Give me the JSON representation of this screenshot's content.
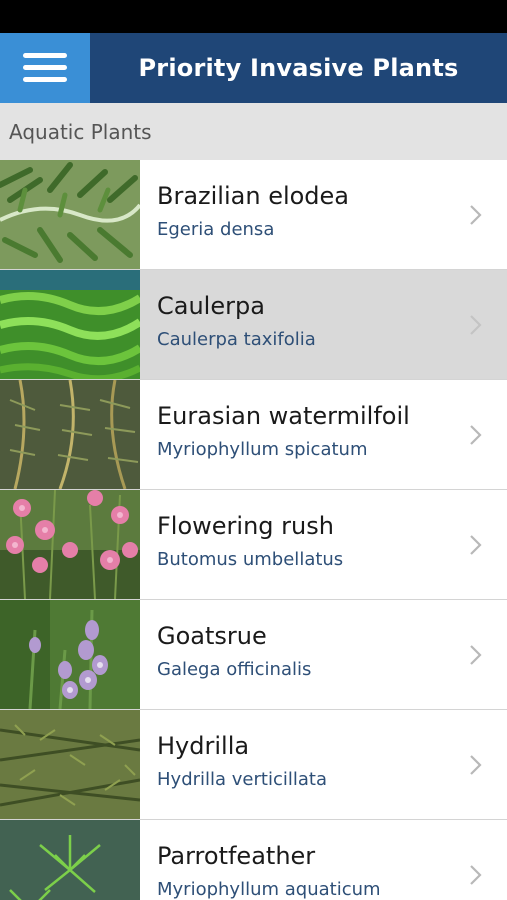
{
  "header": {
    "title": "Priority Invasive Plants",
    "menu_icon": "hamburger-menu-icon"
  },
  "section": {
    "title": "Aquatic Plants"
  },
  "colors": {
    "header_bg": "#1f4677",
    "menu_bg": "#3a8fd6",
    "section_bg": "#e3e3e3",
    "selected_row_bg": "#d9d9d9",
    "scientific_name": "#2e4f77"
  },
  "plants": [
    {
      "common": "Brazilian elodea",
      "scientific": "Egeria densa",
      "selected": false
    },
    {
      "common": "Caulerpa",
      "scientific": "Caulerpa taxifolia",
      "selected": true
    },
    {
      "common": "Eurasian watermilfoil",
      "scientific": "Myriophyllum spicatum",
      "selected": false
    },
    {
      "common": "Flowering rush",
      "scientific": "Butomus umbellatus",
      "selected": false
    },
    {
      "common": "Goatsrue",
      "scientific": "Galega officinalis",
      "selected": false
    },
    {
      "common": "Hydrilla",
      "scientific": "Hydrilla verticillata",
      "selected": false
    },
    {
      "common": "Parrotfeather",
      "scientific": "Myriophyllum aquaticum",
      "selected": false
    }
  ]
}
